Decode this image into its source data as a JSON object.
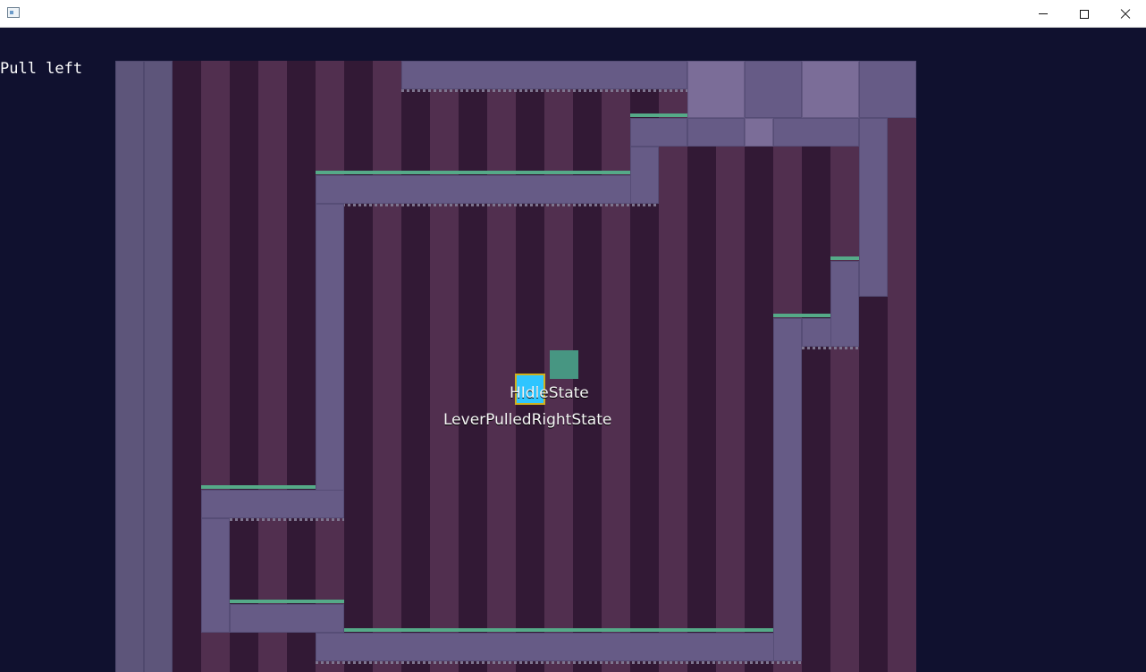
{
  "window": {
    "title": "",
    "icon": "app-window-icon"
  },
  "hud": {
    "status_text": "Pull left"
  },
  "entities": {
    "player": {
      "color": "#2ec5ff",
      "outline": "#cfb11f",
      "state_label": "HIdleState"
    },
    "lever": {
      "color": "#479682",
      "state_label": "LeverPulledRightState"
    },
    "goal": {
      "color": "#1aff3c"
    }
  },
  "colors": {
    "background": "#10112f",
    "wall": "#665b86",
    "grass": "#55aa88",
    "room_dark": "#321935",
    "room_stripe": "#512f4f"
  }
}
